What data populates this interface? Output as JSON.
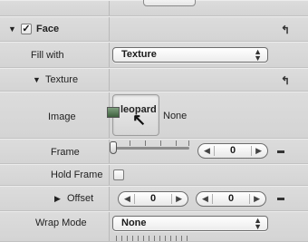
{
  "face": {
    "label": "Face",
    "checked": true
  },
  "fill_with": {
    "label": "Fill with",
    "value": "Texture"
  },
  "texture": {
    "label": "Texture"
  },
  "image": {
    "label": "Image",
    "drag_label": "leopard",
    "value": "None"
  },
  "frame": {
    "label": "Frame",
    "value": "0"
  },
  "hold_frame": {
    "label": "Hold Frame"
  },
  "offset": {
    "label": "Offset",
    "x": "0",
    "y": "0"
  },
  "wrap_mode": {
    "label": "Wrap Mode",
    "value": "None"
  }
}
